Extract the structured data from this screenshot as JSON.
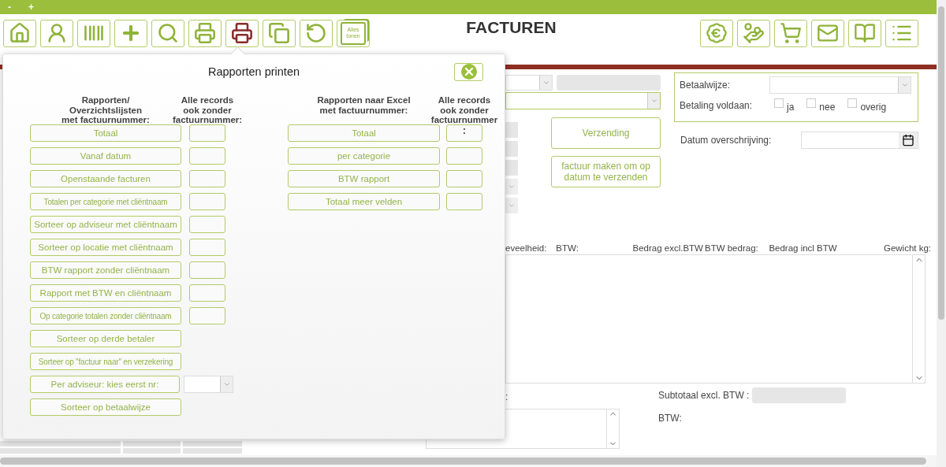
{
  "window": {
    "controls": [
      "-",
      "+"
    ]
  },
  "toolbar": {
    "left": [
      {
        "kind": "home",
        "selected": false
      },
      {
        "kind": "person",
        "selected": false
      },
      {
        "kind": "barcode",
        "selected": false
      },
      {
        "kind": "plus",
        "selected": false
      },
      {
        "kind": "search",
        "selected": false
      },
      {
        "kind": "printer",
        "selected": false
      },
      {
        "kind": "printer-list",
        "selected": true
      },
      {
        "kind": "copy",
        "selected": false
      },
      {
        "kind": "rotate",
        "selected": false
      },
      {
        "kind": "cards",
        "label": "Alles tonen",
        "selected": false
      }
    ],
    "right": [
      {
        "kind": "euro"
      },
      {
        "kind": "money"
      },
      {
        "kind": "cart"
      },
      {
        "kind": "mail"
      },
      {
        "kind": "book"
      },
      {
        "kind": "list"
      }
    ]
  },
  "title": "FACTUREN",
  "form": {
    "verzending_button": "Verzending",
    "schedule_button": "factuur  maken om op datum te verzenden",
    "payment": {
      "label": "Betaalwijze:",
      "paid_label": "Betaling voldaan:",
      "options": [
        {
          "label": "ja",
          "checked": false
        },
        {
          "label": "nee",
          "checked": false
        },
        {
          "label": "overig",
          "checked": false
        }
      ]
    },
    "transfer_date": {
      "label": "Datum overschrijving:"
    },
    "columns": [
      "eveelheid:",
      "BTW:",
      "Bedrag excl.BTW",
      "BTW bedrag:",
      "Bedrag incl BTW",
      "Gewicht kg:"
    ],
    "remark_label": ":",
    "subtotal_label": "Subtotaal excl. BTW :",
    "btw_label": "BTW:"
  },
  "dialog": {
    "title": "Rapporten printen",
    "left": {
      "header": "Rapporten/\nOverzichtslijsten\nmet factuurnummer:",
      "all_header": "Alle records\nook zonder\nfactuurnummer:",
      "reports": [
        {
          "label": "Totaal",
          "kind": "box"
        },
        {
          "label": "Vanaf datum",
          "kind": "box"
        },
        {
          "label": "Openstaande facturen",
          "kind": "box"
        },
        {
          "label": "Totalen per categorie met cliëntnaam",
          "kind": "box"
        },
        {
          "label": "Sorteer op adviseur met cliëntnaam",
          "kind": "box"
        },
        {
          "label": "Sorteer op locatie met cliëntnaam",
          "kind": "box"
        },
        {
          "label": "BTW rapport zonder cliëntnaam",
          "kind": "box"
        },
        {
          "label": "Rapport met BTW en cliëntnaam",
          "kind": "box"
        },
        {
          "label": "Op categorie totalen zonder cliëntnaam",
          "kind": "box"
        },
        {
          "label": "Sorteer op derde betaler",
          "kind": "plain"
        },
        {
          "label": "Sorteer op \"factuur naar\" en verzekering",
          "kind": "plain"
        },
        {
          "label": "Per adviseur: kies eerst nr:",
          "kind": "select"
        },
        {
          "label": "Sorteer op betaalwijze",
          "kind": "plain"
        }
      ]
    },
    "right": {
      "header": "Rapporten naar Excel\nmet factuurnummer:",
      "all_header": "Alle records\nook zonder\nfactuurnummer",
      "reports": [
        {
          "label": "Totaal",
          "kind": "box",
          "box_value": ":"
        },
        {
          "label": "per categorie",
          "kind": "box"
        },
        {
          "label": "BTW  rapport",
          "kind": "box"
        },
        {
          "label": "Totaal meer velden",
          "kind": "box"
        }
      ]
    }
  }
}
